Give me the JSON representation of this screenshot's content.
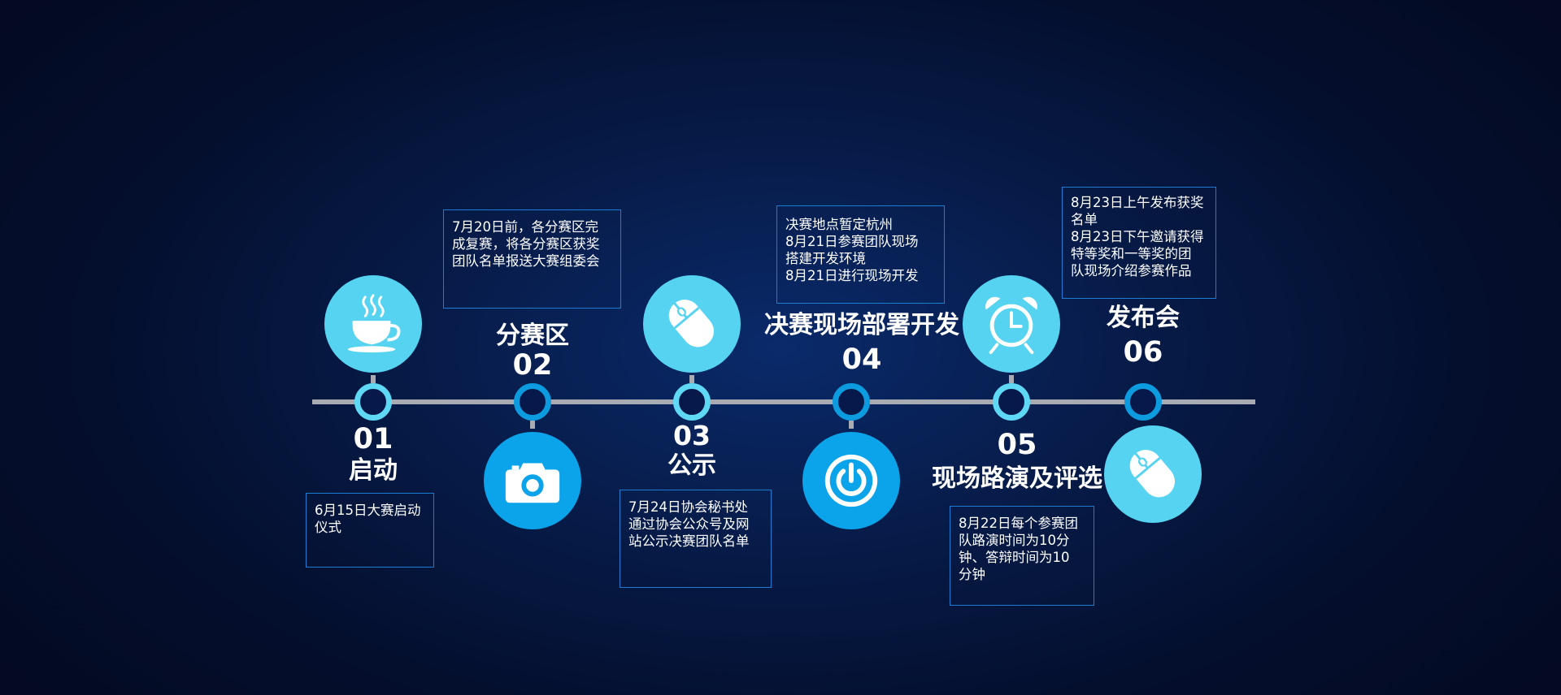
{
  "steps": [
    {
      "number": "01",
      "title": "启动",
      "description": "6月15日大赛启动\n仪式",
      "icon": "coffee-cup-icon"
    },
    {
      "number": "02",
      "title": "分赛区",
      "description": "7月20日前，各分赛区完\n成复赛，将各分赛区获奖\n团队名单报送大赛组委会",
      "icon": "camera-icon"
    },
    {
      "number": "03",
      "title": "公示",
      "description": "7月24日协会秘书处\n通过协会公众号及网\n站公示决赛团队名单",
      "icon": "computer-mouse-icon"
    },
    {
      "number": "04",
      "title": "决赛现场部署开发",
      "description": "决赛地点暂定杭州\n8月21日参赛团队现场\n搭建开发环境\n8月21日进行现场开发",
      "icon": "power-icon"
    },
    {
      "number": "05",
      "title": "现场路演及评选",
      "description": "8月22日每个参赛团\n队路演时间为10分\n钟、答辩时间为10\n分钟",
      "icon": "alarm-clock-icon"
    },
    {
      "number": "06",
      "title": "发布会",
      "description": "8月23日上午发布获奖\n名单\n8月23日下午邀请获得\n特等奖和一等奖的团\n队现场介绍参赛作品",
      "icon": "computer-mouse-icon"
    }
  ],
  "colors": {
    "light_accent": "#55d3f1",
    "dark_accent": "#0ba3ea",
    "line": "#a9abb2",
    "box_border": "#1e7cd3"
  }
}
